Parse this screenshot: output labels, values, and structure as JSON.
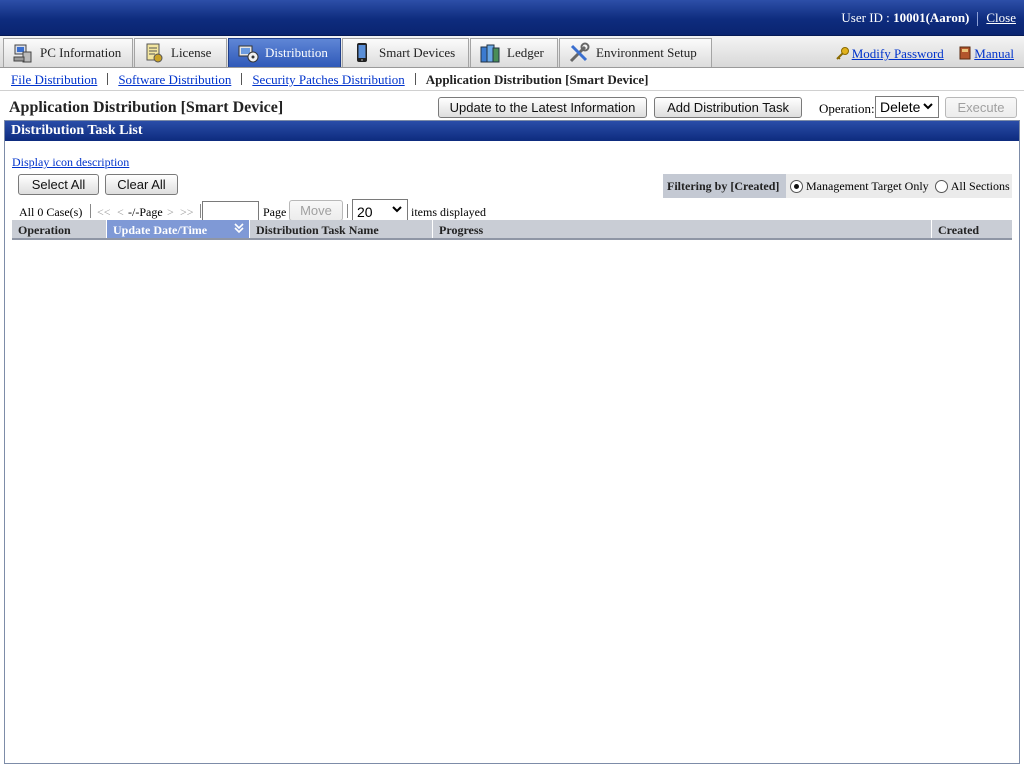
{
  "header": {
    "user_label": "User ID : ",
    "user_id": "10001(Aaron)",
    "close_label": "Close"
  },
  "tabs": [
    {
      "label": "PC Information",
      "icon": "pc-icon",
      "active": false
    },
    {
      "label": "License",
      "icon": "license-icon",
      "active": false
    },
    {
      "label": "Distribution",
      "icon": "distribution-icon",
      "active": true
    },
    {
      "label": "Smart Devices",
      "icon": "smartphone-icon",
      "active": false
    },
    {
      "label": "Ledger",
      "icon": "ledger-icon",
      "active": false
    },
    {
      "label": "Environment Setup",
      "icon": "tools-icon",
      "active": false
    }
  ],
  "toplinks": {
    "modify_password": "Modify Password",
    "manual": "Manual"
  },
  "subnav": {
    "items": [
      "File Distribution",
      "Software Distribution",
      "Security Patches Distribution"
    ],
    "current": "Application Distribution [Smart Device]"
  },
  "page": {
    "title": "Application Distribution [Smart Device]",
    "update_button": "Update to the Latest Information",
    "add_button": "Add Distribution Task",
    "operation_label": "Operation:",
    "operation_value": "Delete",
    "execute_button": "Execute"
  },
  "panel": {
    "title": "Distribution Task List",
    "icon_link": "Display icon description",
    "select_all": "Select All",
    "clear_all": "Clear All",
    "filter_label": "Filtering by [Created]",
    "filter_options": [
      "Management Target Only",
      "All Sections"
    ],
    "filter_selected": "Management Target Only"
  },
  "pager": {
    "count": "All 0 Case(s)",
    "first": "<<",
    "prev": "<",
    "page_text": "-/-Page",
    "next": ">",
    "last": ">>",
    "page_label": "Page",
    "move_button": "Move",
    "per_page": "20",
    "items_label": "items displayed"
  },
  "table": {
    "columns": [
      "Operation",
      "Update Date/Time",
      "Distribution Task Name",
      "Progress",
      "Created"
    ],
    "sorted_column": "Update Date/Time",
    "rows": []
  }
}
